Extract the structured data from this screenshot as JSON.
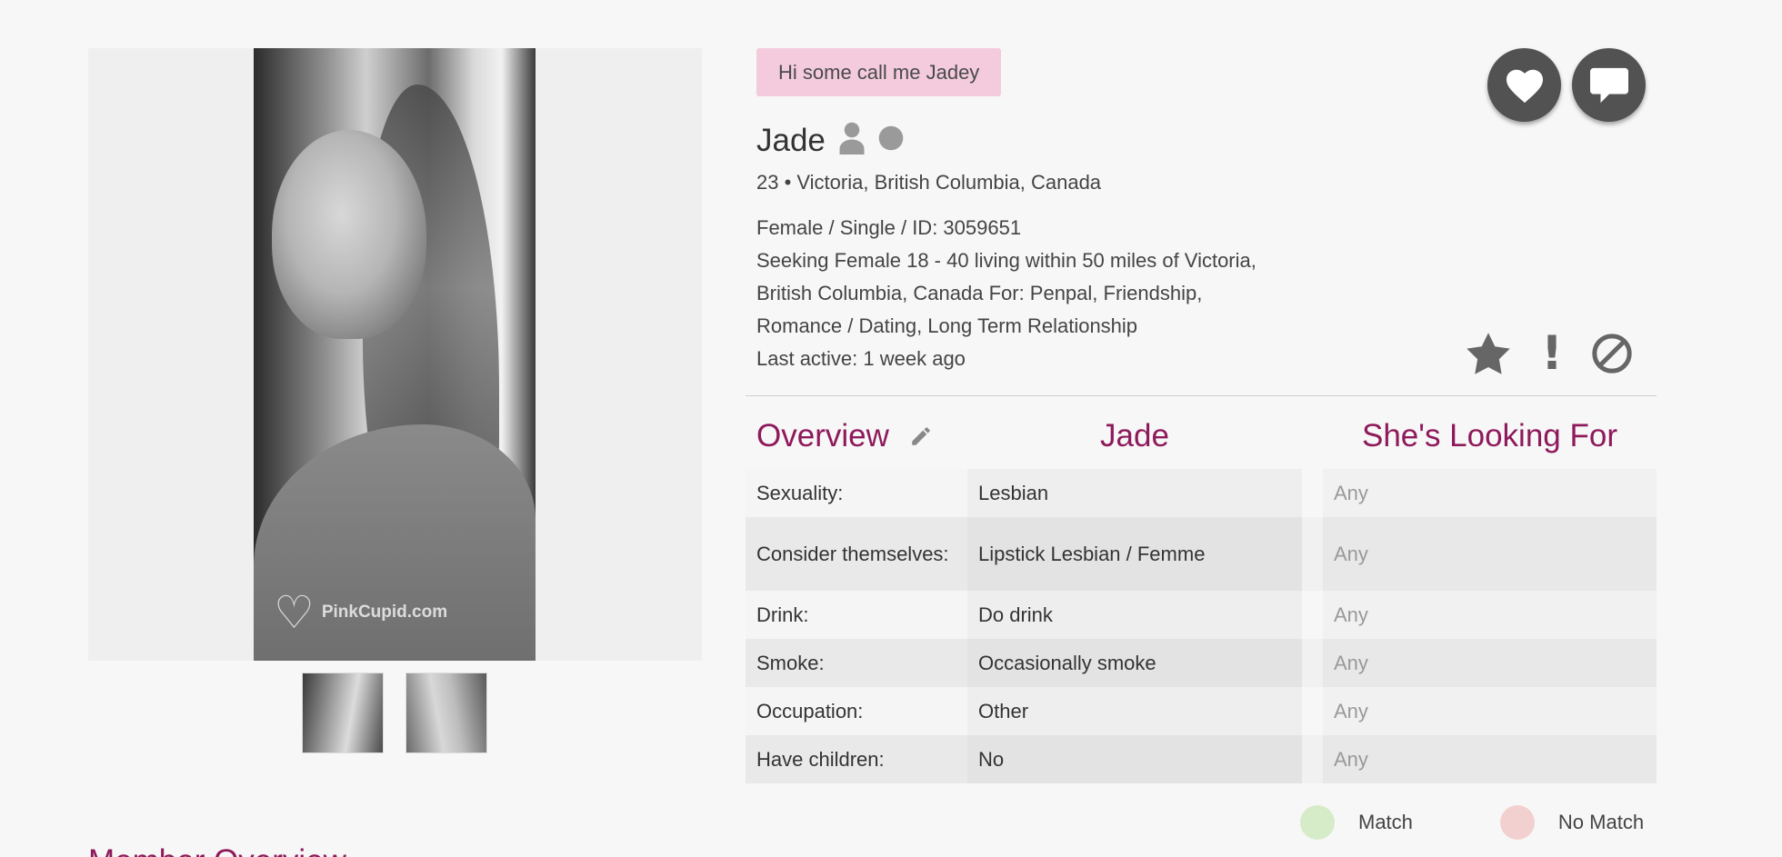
{
  "profile": {
    "tagline": "Hi some call me Jadey",
    "name": "Jade",
    "location": "23 • Victoria, British Columbia, Canada",
    "details": [
      "Female / Single / ID: 3059651",
      "Seeking Female 18 - 40 living within 50 miles of Victoria,",
      "British Columbia, Canada For: Penpal, Friendship,",
      "Romance / Dating, Long Term Relationship",
      "Last active: 1 week ago"
    ]
  },
  "photo": {
    "watermark": "PinkCupid.com",
    "thumbnail_count": 2
  },
  "icons": {
    "like": "heart-icon",
    "message": "chat-bubble-icon",
    "photo_verified": "person-icon",
    "online_status": "circle-icon",
    "favorite": "star-icon",
    "report": "exclamation-icon",
    "block": "block-icon",
    "edit": "pencil-icon"
  },
  "table": {
    "headers": {
      "overview": "Overview",
      "member": "Jade",
      "seeking": "She's Looking For"
    },
    "rows": [
      {
        "label": "Sexuality:",
        "value": "Lesbian",
        "seeking": "Any"
      },
      {
        "label": "Consider themselves:",
        "value": "Lipstick Lesbian / Femme",
        "seeking": "Any"
      },
      {
        "label": "Drink:",
        "value": "Do drink",
        "seeking": "Any"
      },
      {
        "label": "Smoke:",
        "value": "Occasionally smoke",
        "seeking": "Any"
      },
      {
        "label": "Occupation:",
        "value": "Other",
        "seeking": "Any"
      },
      {
        "label": "Have children:",
        "value": "No",
        "seeking": "Any"
      }
    ]
  },
  "legend": {
    "match": "Match",
    "no_match": "No Match"
  },
  "section": {
    "next_heading": "Member Overview"
  },
  "colors": {
    "accent": "#8e1a5b",
    "tagline_bg": "#f3cbdc",
    "button_bg": "#525252",
    "match": "#d6ebc8",
    "no_match": "#f3d0d0"
  }
}
